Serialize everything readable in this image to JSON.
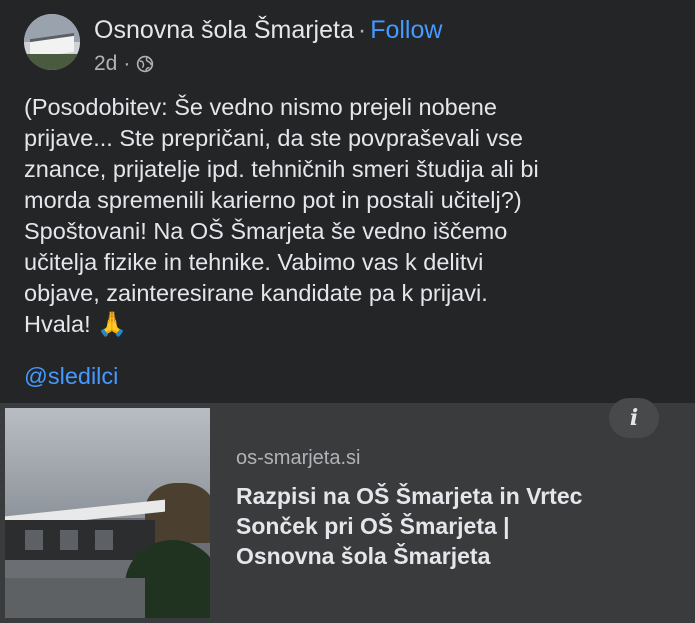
{
  "post": {
    "page_name": "Osnovna šola Šmarjeta",
    "separator": "·",
    "follow_label": "Follow",
    "time": "2d",
    "meta_separator": "·",
    "privacy_icon": "globe-icon",
    "body": "(Posodobitev: Še vedno nismo prejeli nobene\nprijave... Ste prepričani, da ste povpraševali vse\nznance, prijatelje ipd. tehničnih smeri študija ali bi\nmorda spremenili karierno pot in postali učitelj?)\nSpoštovani! Na OŠ Šmarjeta še vedno iščemo\nučitelja fizike in tehnike. Vabimo vas k delitvi\nobjave, zainteresirane kandidate pa k prijavi.\nHvala!",
    "emoji": "🙏",
    "mention": "@sledilci"
  },
  "link_card": {
    "domain": "os-smarjeta.si",
    "title": "Razpisi na OŠ Šmarjeta in Vrtec\nSonček pri OŠ Šmarjeta |\nOsnovna šola Šmarjeta",
    "info_icon": "i"
  },
  "colors": {
    "background": "#242526",
    "card": "#3a3b3c",
    "link": "#4599ff",
    "text": "#e4e6eb",
    "muted": "#b0b3b8"
  }
}
